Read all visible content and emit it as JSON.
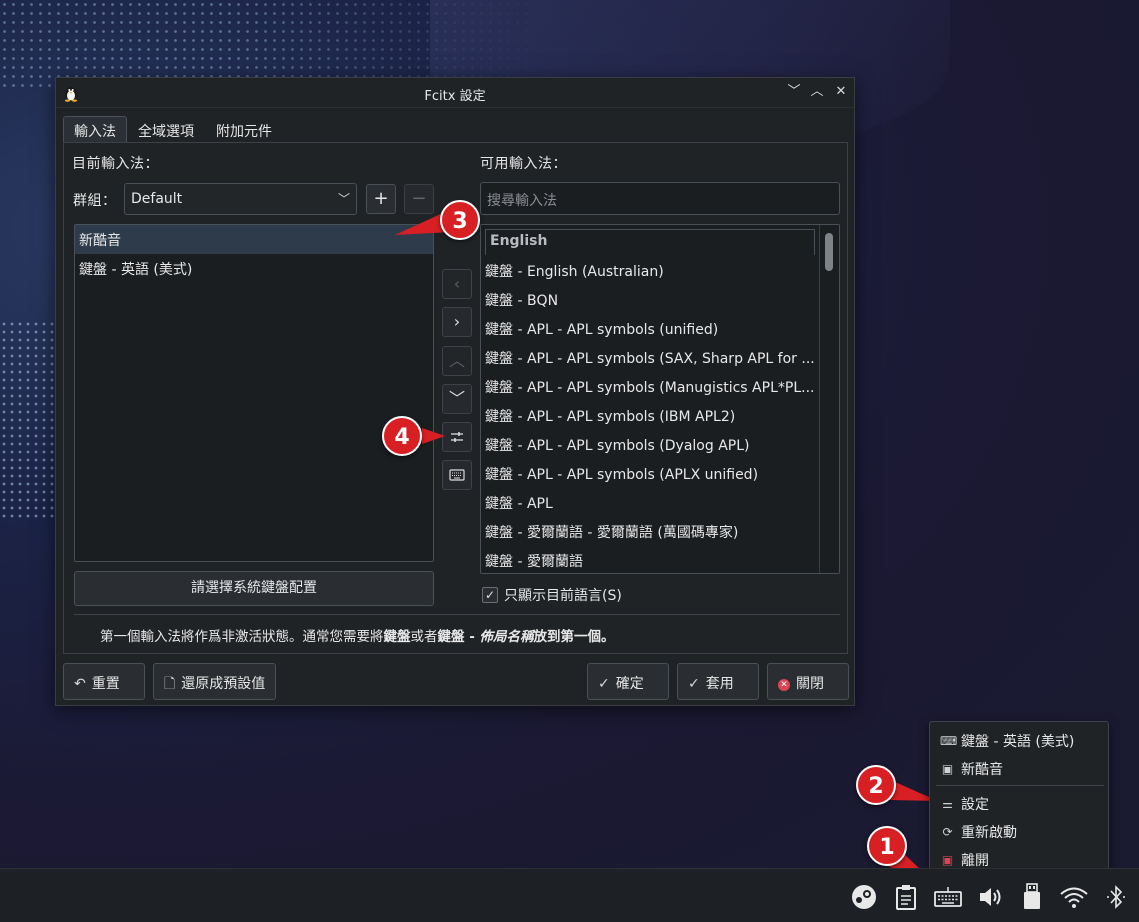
{
  "window": {
    "title": "Fcitx 設定",
    "controls": {
      "minimize": "﹀",
      "maximize": "︿",
      "close": "✕"
    }
  },
  "tabs": [
    "輸入法",
    "全域選項",
    "附加元件"
  ],
  "current": {
    "label": "目前輸入法：",
    "group_label": "群組：",
    "group_value": "Default",
    "add": "+",
    "remove": "−",
    "items": [
      "新酷音",
      "鍵盤 - 英語 (美式)"
    ],
    "keyboard_button": "請選擇系統鍵盤配置"
  },
  "available": {
    "label": "可用輸入法：",
    "search_placeholder": "搜尋輸入法",
    "section_header": "English",
    "items": [
      "鍵盤 - English (Australian)",
      "鍵盤 - BQN",
      "鍵盤 - APL - APL symbols (unified)",
      "鍵盤 - APL - APL symbols (SAX, Sharp APL for ...",
      "鍵盤 - APL - APL symbols (Manugistics APL*PL...",
      "鍵盤 - APL - APL symbols (IBM APL2)",
      "鍵盤 - APL - APL symbols (Dyalog APL)",
      "鍵盤 - APL - APL symbols (APLX unified)",
      "鍵盤 - APL",
      "鍵盤 - 愛爾蘭語 - 愛爾蘭語 (萬國碼專家)",
      "鍵盤 - 愛爾蘭語"
    ],
    "only_current_language": "只顯示目前語言(S)"
  },
  "hint": {
    "part1": "第一個輸入法將作爲非激活狀態。通常您需要將",
    "bold1": "鍵盤",
    "part2": "或者",
    "bold2": "鍵盤 - ",
    "italic": "佈局名稱",
    "part3": "放到第一個。"
  },
  "footer": {
    "reset": "重置",
    "defaults": "還原成預設值",
    "ok": "確定",
    "apply": "套用",
    "close": "關閉"
  },
  "callouts": [
    "1",
    "2",
    "3",
    "4"
  ],
  "tray_menu": {
    "items": [
      "鍵盤 - 英語 (美式)",
      "新酷音",
      "設定",
      "重新啟動",
      "離開"
    ]
  },
  "colors": {
    "accent_red": "#d81f23",
    "selection": "#2d3b4a",
    "close_red": "#da4453"
  }
}
